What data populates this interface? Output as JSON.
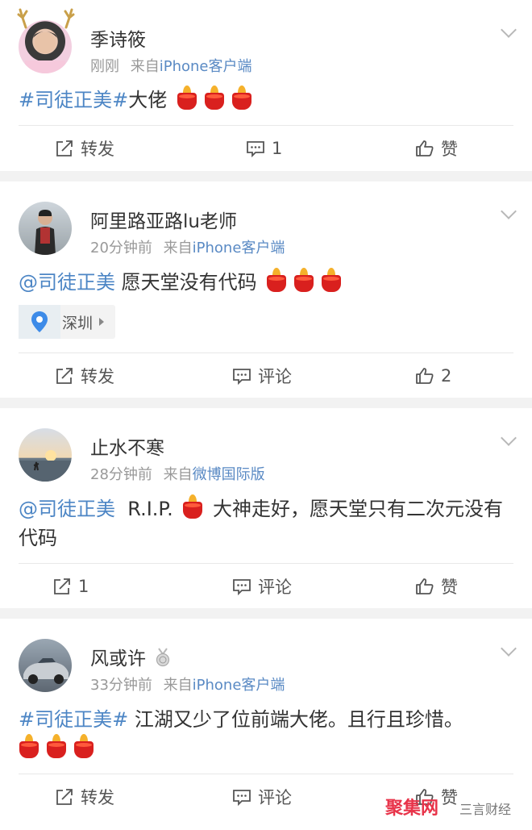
{
  "posts": [
    {
      "username": "季诗筱",
      "time": "刚刚",
      "from_label": "来自",
      "source": "iPhone客户端",
      "text_tag": "#司徒正美#",
      "text_body": "大佬",
      "actions": {
        "repost": "转发",
        "comment": "1",
        "like": "赞"
      }
    },
    {
      "username": "阿里路亚路lu老师",
      "time": "20分钟前",
      "from_label": "来自",
      "source": "iPhone客户端",
      "text_tag": "@司徒正美",
      "text_body": " 愿天堂没有代码",
      "location": "深圳",
      "actions": {
        "repost": "转发",
        "comment": "评论",
        "like": "2"
      }
    },
    {
      "username": "止水不寒",
      "time": "28分钟前",
      "from_label": "来自",
      "source": "微博国际版",
      "text_tag": "@司徒正美",
      "text_pre": "  R.I.P.",
      "text_body": " 大神走好，愿天堂只有二次元没有代码",
      "actions": {
        "repost": "1",
        "comment": "评论",
        "like": "赞"
      }
    },
    {
      "username": "风或许",
      "time": "33分钟前",
      "from_label": "来自",
      "source": "iPhone客户端",
      "text_tag": "#司徒正美#",
      "text_body": " 江湖又少了位前端大佬。且行且珍惜。",
      "actions": {
        "repost": "转发",
        "comment": "评论",
        "like": "赞"
      }
    }
  ],
  "watermark": {
    "brand": "聚集网",
    "sub": "三言财经"
  },
  "colors": {
    "link": "#4d86c5",
    "candle_red": "#d9201e",
    "flame": "#f5b12b"
  }
}
